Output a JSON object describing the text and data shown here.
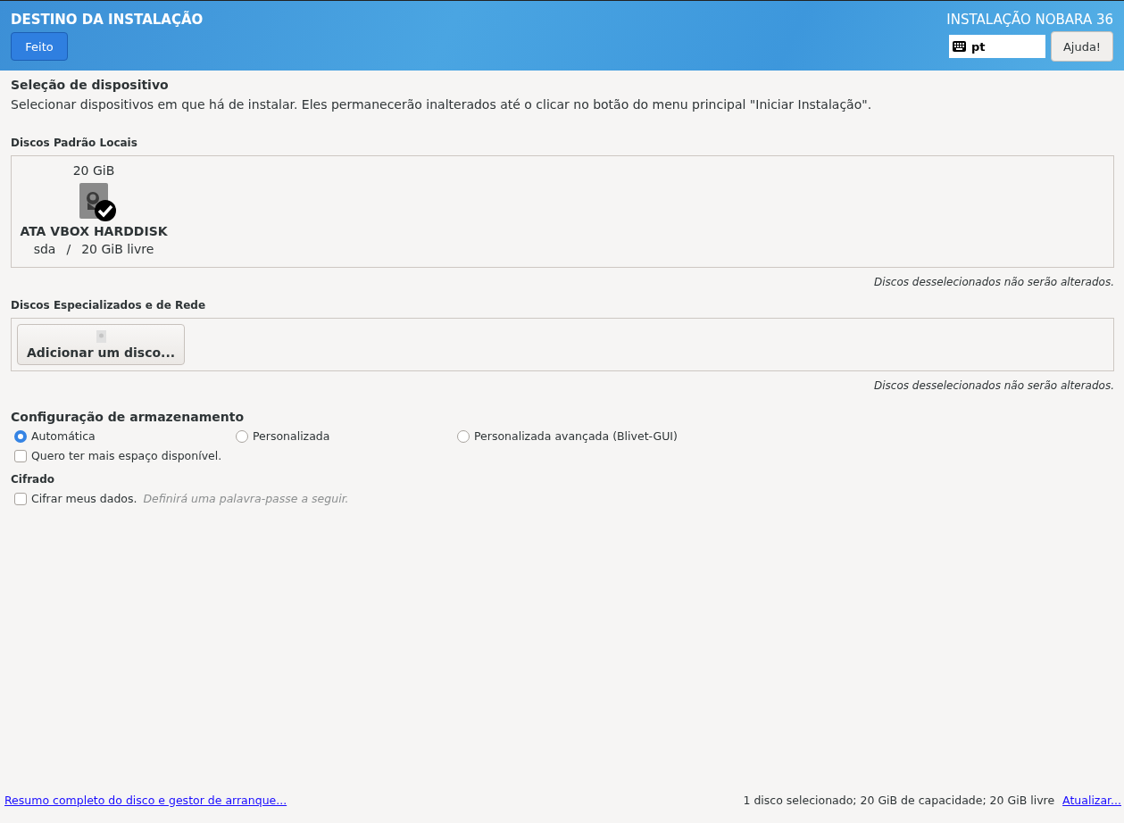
{
  "header": {
    "title": "DESTINO DA INSTALAÇÃO",
    "done_button": "Feito",
    "product_title": "INSTALAÇÃO NOBARA 36",
    "keyboard_layout": "pt",
    "help_button": "Ajuda!"
  },
  "device_selection": {
    "title": "Seleção de dispositivo",
    "description": "Selecionar dispositivos em que há de instalar.  Eles permanecerão inalterados até o clicar no botão do menu principal \"Iniciar Instalação\"."
  },
  "local_disks": {
    "label": "Discos Padrão Locais",
    "disks": [
      {
        "size": "20 GiB",
        "name": "ATA VBOX HARDDISK",
        "device": "sda",
        "separator": "/",
        "free": "20 GiB livre",
        "selected": true
      }
    ],
    "note": "Discos desselecionados não serão alterados."
  },
  "specialized_disks": {
    "label": "Discos Especializados e de Rede",
    "add_button": "Adicionar um disco...",
    "note": "Discos desselecionados não serão alterados."
  },
  "storage_configuration": {
    "title": "Configuração de armazenamento",
    "options": [
      {
        "label": "Automática",
        "selected": true
      },
      {
        "label": "Personalizada",
        "selected": false
      },
      {
        "label": "Personalizada avançada (Blivet-GUI)",
        "selected": false
      }
    ],
    "reclaim": {
      "label": "Quero ter mais espaço disponível.",
      "checked": false
    }
  },
  "encryption": {
    "title": "Cifrado",
    "label": "Cifrar meus dados.",
    "hint": "Definirá uma palavra-passe a seguir.",
    "checked": false
  },
  "footer": {
    "summary_link": "Resumo completo do disco e gestor de arranque...",
    "status": "1 disco selecionado; 20 GiB de capacidade; 20 GiB livre",
    "refresh_link": "Atualizar..."
  }
}
